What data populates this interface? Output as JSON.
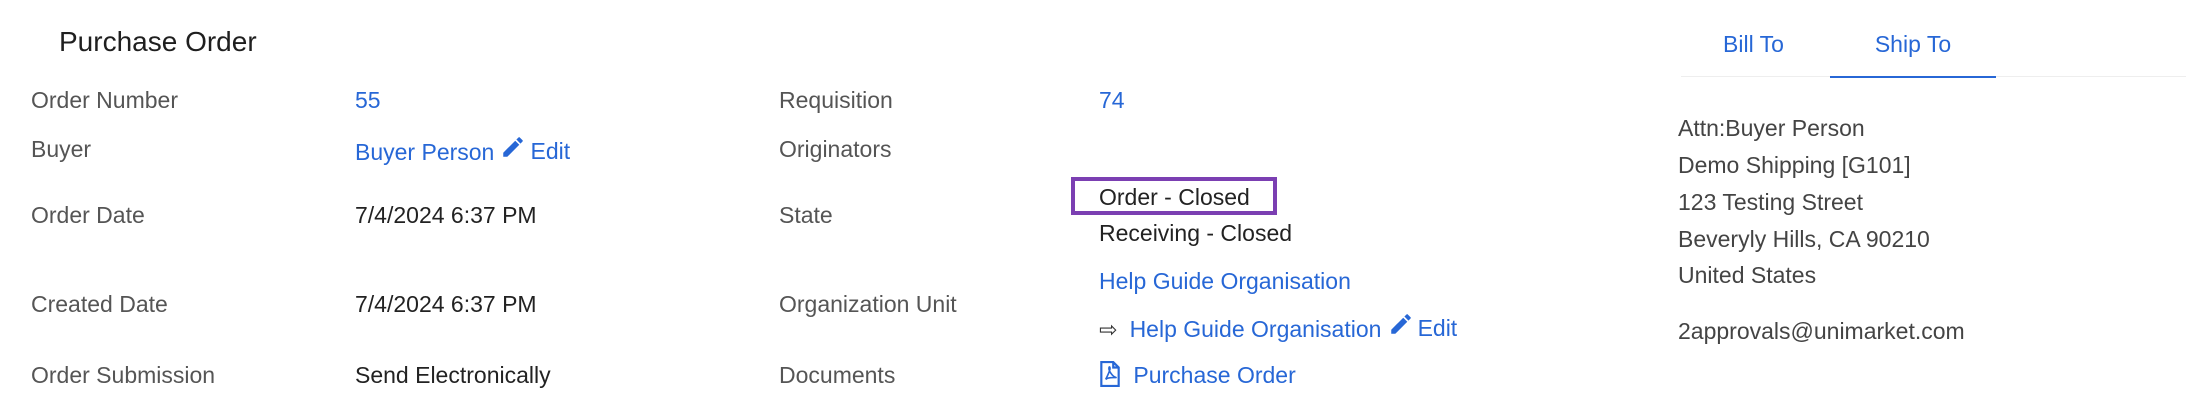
{
  "section_title": "Purchase Order",
  "left": {
    "order_number": {
      "label": "Order Number",
      "value": "55"
    },
    "buyer": {
      "label": "Buyer",
      "value": "Buyer Person",
      "edit": "Edit"
    },
    "order_date": {
      "label": "Order Date",
      "value": "7/4/2024 6:37 PM"
    },
    "created_date": {
      "label": "Created Date",
      "value": "7/4/2024 6:37 PM"
    },
    "order_submission": {
      "label": "Order Submission",
      "value": "Send Electronically"
    }
  },
  "middle": {
    "requisition": {
      "label": "Requisition",
      "value": "74"
    },
    "originators": {
      "label": "Originators"
    },
    "state": {
      "label": "State",
      "order_state": "Order - Closed",
      "receiving_state": "Receiving - Closed"
    },
    "org_unit": {
      "label": "Organization Unit",
      "primary": "Help Guide Organisation",
      "arrow": "⇨",
      "secondary": "Help Guide Organisation",
      "edit": "Edit"
    },
    "documents": {
      "label": "Documents",
      "link": "Purchase Order"
    }
  },
  "tabs": [
    {
      "label": "Bill To",
      "active": false
    },
    {
      "label": "Ship To",
      "active": true
    }
  ],
  "ship_to": {
    "lines": [
      "Attn:Buyer Person",
      "Demo Shipping [G101]",
      "123 Testing Street",
      "Beveryly Hills, CA 90210",
      "United States"
    ],
    "email": "2approvals@unimarket.com"
  },
  "colors": {
    "link": "#2767d6",
    "highlight_box": "#7b3fb2"
  },
  "icons": {
    "edit": "pencil-icon",
    "document": "pdf-file-icon"
  }
}
